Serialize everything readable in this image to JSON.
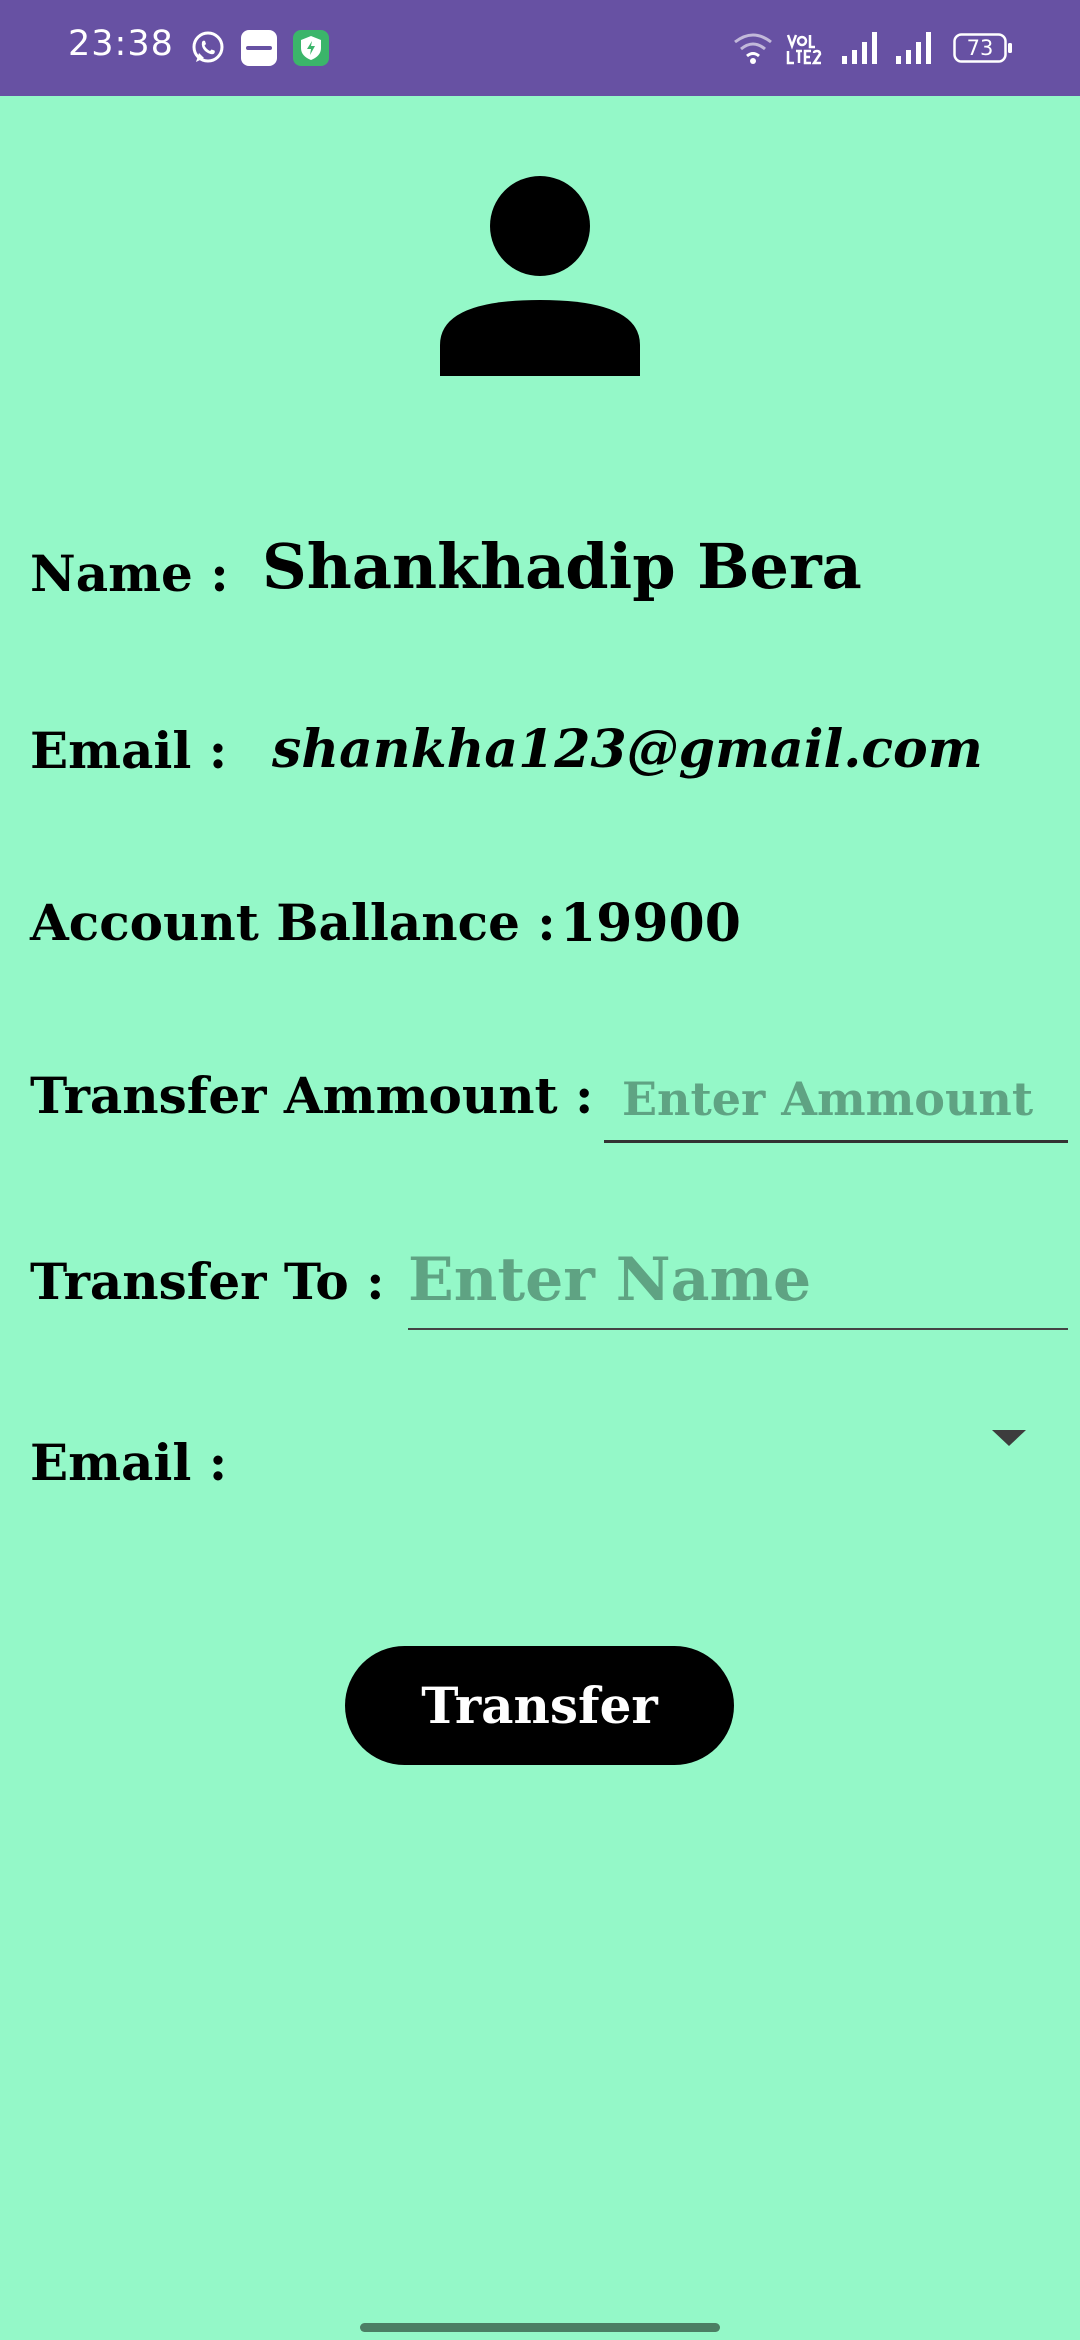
{
  "status_bar": {
    "time": "23:38",
    "network_label": "VoLTE2",
    "battery": "73",
    "bg_color": "#6751a3",
    "icons": [
      "whatsapp-icon",
      "zomato-icon",
      "shield-app-icon",
      "wifi-icon",
      "volte-icon",
      "signal-icon",
      "signal-icon",
      "battery-icon"
    ]
  },
  "profile": {
    "avatar_icon": "person-icon",
    "name_label": "Name :",
    "name_value": "Shankhadip Bera",
    "email_label": "Email :",
    "email_value": "shankha123@gmail.com",
    "balance_label": "Account Ballance :",
    "balance_value": "19900"
  },
  "transfer_form": {
    "amount_label": "Transfer Ammount :",
    "amount_placeholder": "Enter Ammount",
    "amount_value": "",
    "to_label": "Transfer To :",
    "to_placeholder": "Enter Name",
    "to_value": "",
    "email_label": "Email :",
    "email_selected": "",
    "submit_label": "Transfer"
  },
  "colors": {
    "background": "#94f8c8",
    "button": "#000000",
    "placeholder": "#5fa383"
  }
}
